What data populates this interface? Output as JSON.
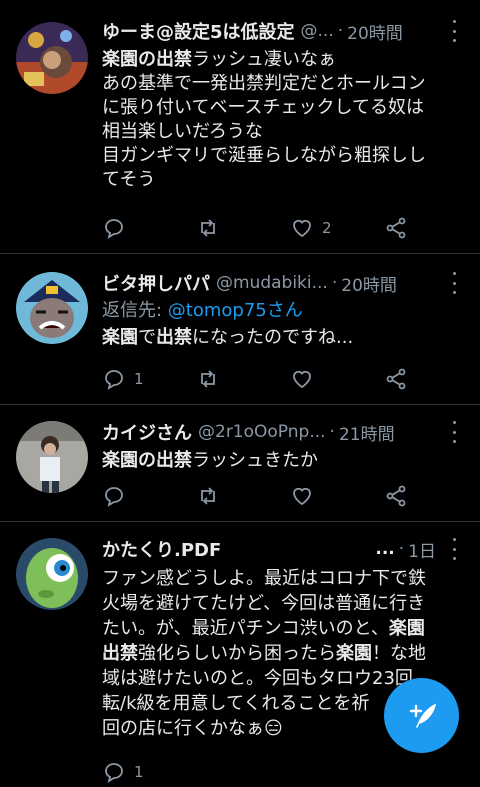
{
  "tweets": [
    {
      "name": "ゆーま@設定5は低設定",
      "handle": "@...",
      "time": "20時間",
      "lines": [
        [
          {
            "t": "楽園の出禁",
            "b": true
          },
          {
            "t": "ラッシュ凄いなぁ",
            "b": false
          }
        ],
        [
          {
            "t": "あの基準で一発出禁判定だとホールコン",
            "b": false
          }
        ],
        [
          {
            "t": "に張り付いてベースチェックしてる奴は",
            "b": false
          }
        ],
        [
          {
            "t": "相当楽しいだろうな",
            "b": false
          }
        ],
        [
          {
            "t": "目ガンギマリで涎垂らしながら粗探しし",
            "b": false
          }
        ],
        [
          {
            "t": "てそう",
            "b": false
          }
        ]
      ],
      "reply_count": "",
      "retweet_count": "",
      "like_count": "2"
    },
    {
      "name": "ビタ押しパパ",
      "handle": "@mudabiki...",
      "time": "20時間",
      "reply_prefix": "返信先: ",
      "reply_mention": "@tomop75さん",
      "lines": [
        [
          {
            "t": "楽園",
            "b": true
          },
          {
            "t": "で",
            "b": false
          },
          {
            "t": "出禁",
            "b": true
          },
          {
            "t": "になったのですね...",
            "b": false
          }
        ]
      ],
      "reply_count": "1",
      "retweet_count": "",
      "like_count": ""
    },
    {
      "name": "カイジさん",
      "handle": "@2r1oOoPnp...",
      "time": "21時間",
      "lines": [
        [
          {
            "t": "楽園の出禁",
            "b": true
          },
          {
            "t": "ラッシュきたか",
            "b": false
          }
        ]
      ],
      "reply_count": "",
      "retweet_count": "",
      "like_count": ""
    },
    {
      "name": "かたくり.PDF",
      "handle": "...",
      "time": "1日",
      "lines": [
        [
          {
            "t": "ファン感どうしよ。最近はコロナ下で鉄",
            "b": false
          }
        ],
        [
          {
            "t": "火場を避けてたけど、今回は普通に行き",
            "b": false
          }
        ],
        [
          {
            "t": "たい。が、最近パチンコ渋いのと、",
            "b": false
          },
          {
            "t": "楽園",
            "b": true
          }
        ],
        [
          {
            "t": "出禁",
            "b": true
          },
          {
            "t": "強化らしいから困ったら",
            "b": false
          },
          {
            "t": "楽園",
            "b": true
          },
          {
            "t": "！な地",
            "b": false
          }
        ],
        [
          {
            "t": "域は避けたいのと。今回もタロウ23回",
            "b": false
          }
        ],
        [
          {
            "t": "転/k級を用意してくれることを祈",
            "b": false
          }
        ],
        [
          {
            "t": "回の店に行くかなぁ😑",
            "b": false
          }
        ]
      ],
      "reply_count": "1",
      "retweet_count": "",
      "like_count": ""
    }
  ],
  "icons": {
    "reply": "reply-icon",
    "retweet": "retweet-icon",
    "like": "like-icon",
    "share": "share-icon",
    "compose": "compose-tweet-icon",
    "more": "more-options-icon"
  },
  "colors": {
    "accent": "#1d9bf0",
    "muted": "#8b98a5",
    "text": "#e7e9ea",
    "bg": "#000000"
  }
}
